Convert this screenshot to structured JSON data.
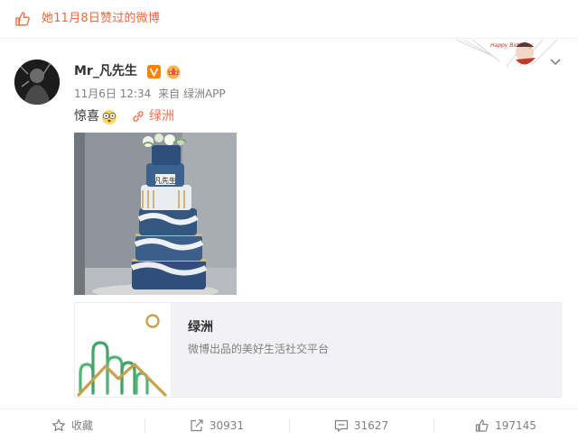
{
  "top_notice": {
    "text": "她11月8日赞过的微博"
  },
  "decor": {
    "label": "Happy Birthday"
  },
  "post": {
    "username": "Mr_凡先生",
    "time": "11月6日 12:34",
    "source": "来自 绿洲APP",
    "text": "惊喜",
    "emoji_icon": "shocked-emoji",
    "link_text": "绿洲",
    "photo_label": "凡先生"
  },
  "share_card": {
    "title": "绿洲",
    "description": "微博出品的美好生活社交平台"
  },
  "actions": {
    "favorite": "收藏",
    "repost": "30931",
    "comment": "31627",
    "like": "197145"
  },
  "colors": {
    "accent_orange": "#eb7350",
    "oasis_green": "#56b47a",
    "oasis_gold": "#c8a24a",
    "verified": "#ff8200"
  }
}
